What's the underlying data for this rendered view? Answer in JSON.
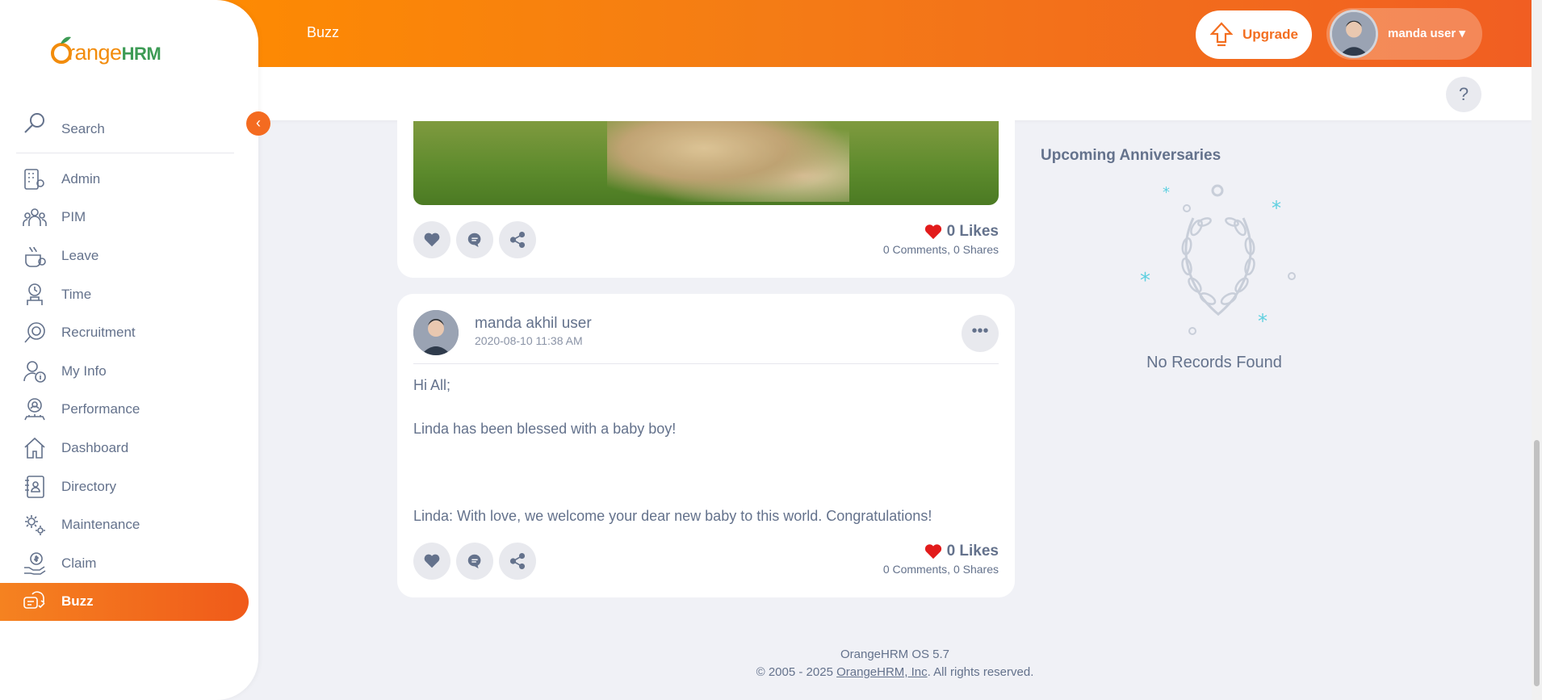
{
  "brand": {
    "part1": "range",
    "part2": "HRM",
    "first_letter": "O"
  },
  "header": {
    "title": "Buzz",
    "upgrade_label": "Upgrade",
    "user_name": "manda user",
    "help": "?"
  },
  "sidebar": {
    "search_placeholder": "Search",
    "collapse": "‹",
    "items": [
      {
        "label": "Admin",
        "icon": "admin-icon"
      },
      {
        "label": "PIM",
        "icon": "pim-icon"
      },
      {
        "label": "Leave",
        "icon": "leave-icon"
      },
      {
        "label": "Time",
        "icon": "time-icon"
      },
      {
        "label": "Recruitment",
        "icon": "recruitment-icon"
      },
      {
        "label": "My Info",
        "icon": "my-info-icon"
      },
      {
        "label": "Performance",
        "icon": "performance-icon"
      },
      {
        "label": "Dashboard",
        "icon": "dashboard-icon"
      },
      {
        "label": "Directory",
        "icon": "directory-icon"
      },
      {
        "label": "Maintenance",
        "icon": "maintenance-icon"
      },
      {
        "label": "Claim",
        "icon": "claim-icon"
      },
      {
        "label": "Buzz",
        "icon": "buzz-icon",
        "active": true
      }
    ]
  },
  "posts": [
    {
      "likes": "0 Likes",
      "comments": "0 Comments",
      "shares": "0 Shares"
    },
    {
      "author": "manda akhil user",
      "date": "2020-08-10 11:38 AM",
      "more": "•••",
      "lines": [
        "Hi All;",
        "",
        "Linda has been blessed with a baby boy!",
        "",
        "",
        "",
        "Linda: With love, we welcome your dear new baby to this world. Congratulations!"
      ],
      "likes": "0 Likes",
      "comments": "0 Comments",
      "shares": "0 Shares"
    }
  ],
  "anniversaries": {
    "title": "Upcoming Anniversaries",
    "empty": "No Records Found"
  },
  "footer": {
    "version": "OrangeHRM OS 5.7",
    "copyright_prefix": "© 2005 - 2025 ",
    "company_link": "OrangeHRM, Inc",
    "copyright_suffix": ". All rights reserved."
  },
  "colors": {
    "accent": "#f46b20",
    "gradient_start": "#ff8c00",
    "gradient_end": "#f15e22",
    "heart": "#e21b1b"
  }
}
